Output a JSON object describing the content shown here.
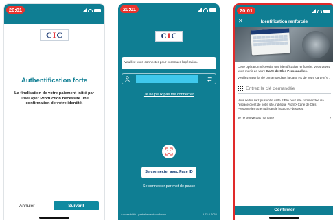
{
  "status_bar": {
    "time": "20:01"
  },
  "brand": {
    "logo_text_left": "C",
    "logo_text_mid": "I",
    "logo_text_right": "C"
  },
  "panel1": {
    "title": "Authentification forte",
    "body": "La finalisation de votre paiement initié par TrueLayer Production nécessite une confirmation de votre identité.",
    "cancel_label": "Annuler",
    "next_label": "Suivant"
  },
  "panel2": {
    "notice": "Veuillez vous connecter pour continuer l'opération.",
    "lost_link": "Je ne peux pas me connecter",
    "faceid_button": "Se connecter avec Face ID",
    "password_link": "Se connecter par mot de passe",
    "footer_left": "Accessibilité : partiellement conforme",
    "footer_right": "9.72.0.2056"
  },
  "panel3": {
    "title": "Identification renforcée",
    "para1_a": "Cette opération nécessite une identification renforcée. Vous devez vous munir de votre ",
    "para1_b": "Carte de Clés Personnelles",
    "para2": "Veuillez saisir la clé contenue dans la case H1 de votre carte n°6 :",
    "key_placeholder": "Entrez la clé demandée",
    "para3": "Vous ne trouvez plus votre carte ? Elle peut être commandée via l'espace client de notre site, rubrique Profil > Carte de Clés Personnelles ou en utilisant le bouton ci-dessous.",
    "lost_card": "Je ne trouve pas ma carte",
    "confirm_label": "Confirmer"
  },
  "colors": {
    "teal": "#0f7e93",
    "accent_red": "#e8332d",
    "navy": "#1c3b74"
  }
}
